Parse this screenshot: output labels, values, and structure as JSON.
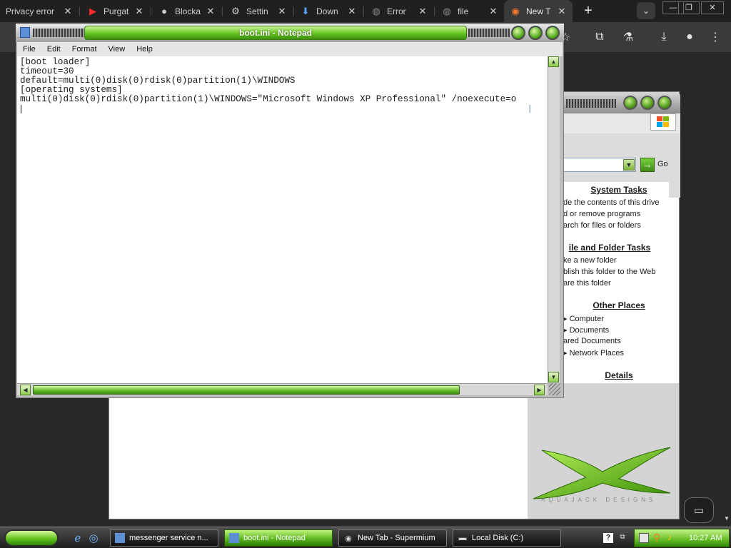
{
  "tabs": [
    {
      "title": "Privacy error",
      "icon": "warning-icon"
    },
    {
      "title": "Purgat",
      "icon": "youtube-icon"
    },
    {
      "title": "Blocka",
      "icon": "github-icon"
    },
    {
      "title": "Settin",
      "icon": "gear-icon"
    },
    {
      "title": "Down",
      "icon": "download-icon"
    },
    {
      "title": "Error",
      "icon": "globe-icon"
    },
    {
      "title": "file",
      "icon": "globe-icon"
    },
    {
      "title": "New T",
      "icon": "supermium-icon"
    }
  ],
  "window_controls": {
    "minimize": "—",
    "restore": "❐",
    "close": "✕"
  },
  "notepad": {
    "title": "boot.ini - Notepad",
    "menu": [
      "File",
      "Edit",
      "Format",
      "View",
      "Help"
    ],
    "lines": [
      "[boot loader]",
      "timeout=30",
      "default=multi(0)disk(0)rdisk(0)partition(1)\\WINDOWS",
      "[operating systems]",
      "multi(0)disk(0)rdisk(0)partition(1)\\WINDOWS=\"Microsoft Windows XP Professional\" /noexecute=o"
    ]
  },
  "explorer": {
    "go_label": "Go",
    "sections": [
      {
        "heading": "System Tasks",
        "items": [
          "de the contents of this drive",
          "d or remove programs",
          "arch for files or folders"
        ]
      },
      {
        "heading": "ile and Folder Tasks",
        "items": [
          "ke a new folder",
          "blish this folder to the Web",
          "are this folder"
        ]
      },
      {
        "heading": "Other Places",
        "items": [
          "Computer",
          "Documents",
          "ared Documents",
          "Network Places"
        ]
      },
      {
        "heading": "Details",
        "items": []
      }
    ],
    "logo_text": "AQUAJACK DESIGNS"
  },
  "taskbar": {
    "tasks": [
      {
        "label": "messenger service n...",
        "icon": "notepad-icon",
        "active": false
      },
      {
        "label": "boot.ini - Notepad",
        "icon": "notepad-icon",
        "active": true
      },
      {
        "label": "New Tab - Supermium",
        "icon": "chrome-icon",
        "active": false
      },
      {
        "label": "Local Disk (C:)",
        "icon": "drive-icon",
        "active": false
      }
    ],
    "help": "?",
    "clock": "10:27 AM"
  },
  "colors": {
    "xp_green": "#62b826",
    "dark_chrome": "#202020",
    "toolbar": "#3a3a3a"
  }
}
